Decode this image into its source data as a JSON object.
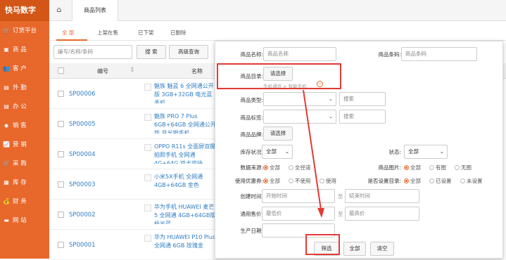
{
  "app": {
    "logo": "快马数字"
  },
  "sidebar": {
    "items": [
      {
        "icon": "cart-icon",
        "glyph": "🛒",
        "label": "订货平台"
      },
      {
        "icon": "product-icon",
        "glyph": "▣",
        "label": "商 品"
      },
      {
        "icon": "customer-icon",
        "glyph": "👥",
        "label": "客 户"
      },
      {
        "icon": "field-icon",
        "glyph": "▤",
        "label": "外 勤"
      },
      {
        "icon": "office-icon",
        "glyph": "▤",
        "label": "办 公"
      },
      {
        "icon": "sales-icon",
        "glyph": "◆",
        "label": "销 售"
      },
      {
        "icon": "marketing-icon",
        "glyph": "📈",
        "label": "营 销"
      },
      {
        "icon": "purchase-icon",
        "glyph": "🛒",
        "label": "采 购"
      },
      {
        "icon": "inventory-icon",
        "glyph": "▦",
        "label": "库 存"
      },
      {
        "icon": "finance-icon",
        "glyph": "💰",
        "label": "财 务"
      },
      {
        "icon": "website-icon",
        "glyph": "▬",
        "label": "网 站"
      }
    ]
  },
  "topbar": {
    "tab": "商品列表"
  },
  "subtabs": [
    "全 部",
    "上架在售",
    "已下架",
    "已删除"
  ],
  "toolbar": {
    "search_placeholder": "编号/名称/条码",
    "search_btn": "搜 索",
    "advanced_btn": "高级查询"
  },
  "table": {
    "headers": {
      "code": "编号",
      "name": "名称"
    },
    "rows": [
      {
        "code": "SP00006",
        "name": "魅族 魅蓝 6 全网通公开版 3GB+32GB 电光蓝手机"
      },
      {
        "code": "SP00005",
        "name": "魅族 PRO 7 Plus 6GB+64GB 全网通公开版 月光银手机"
      },
      {
        "code": "SP00004",
        "name": "OPPO R11s 全面屏双摄拍照手机 全网通4G+64G 双卡双待"
      },
      {
        "code": "SP00003",
        "name": "小米5X手机 全网通 4GB+64GB 金色"
      },
      {
        "code": "SP00002",
        "name": "华为手机 HUAWEI 麦芒5 全网通 4GB+64GB版 极光蓝"
      },
      {
        "code": "SP00001",
        "name": "华为 HUAWEI P10 Plus 全网通 6GB 玫瑰金"
      }
    ]
  },
  "filter": {
    "name_label": "商品名称:",
    "name_placeholder": "商品名称",
    "barcode_label": "商品条码:",
    "barcode_placeholder": "商品条码",
    "catalog_label": "商品目录:",
    "catalog_btn": "请选择",
    "catalog_path": "手机通讯 > 智能手机",
    "type_label": "商品类型:",
    "type_search": "搜索",
    "tag_label": "商品标签:",
    "tag_search": "搜索",
    "brand_label": "商品品牌:",
    "brand_btn": "请选择",
    "stock_label": "库存状况:",
    "stock_value": "全部",
    "status_label": "状态:",
    "status_value": "全部",
    "source_label": "数据来源:",
    "source_opts": [
      "全部",
      "全径道"
    ],
    "image_label": "商品图片:",
    "image_opts": [
      "全部",
      "有图",
      "无图"
    ],
    "coupon_label": "使用优惠券:",
    "coupon_opts": [
      "全部",
      "不使用",
      "使用"
    ],
    "catalog_set_label": "是否设置目录:",
    "catalog_set_opts": [
      "全部",
      "已设置",
      "未设置"
    ],
    "created_label": "创建时间:",
    "start_placeholder": "开始时间",
    "to": "至",
    "end_placeholder": "结束时间",
    "price_label": "通用售价:",
    "min_placeholder": "最低价",
    "max_placeholder": "最高价",
    "date_label": "生产日期:",
    "filter_btn": "筛选",
    "all_btn": "全部",
    "clear_btn": "清空"
  },
  "colors": {
    "accent": "#e8672b",
    "highlight": "#e53935",
    "link": "#2f7cc2"
  }
}
